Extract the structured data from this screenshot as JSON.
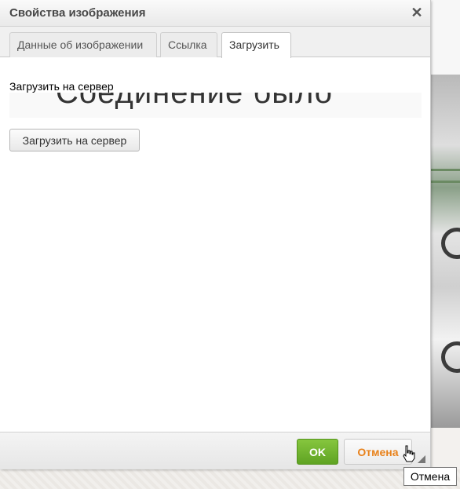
{
  "dialog": {
    "title": "Свойства изображения",
    "close_icon": "close-icon"
  },
  "tabs": [
    {
      "label": "Данные об изображении",
      "active": false
    },
    {
      "label": "Ссылка",
      "active": false
    },
    {
      "label": "Загрузить",
      "active": true
    }
  ],
  "upload": {
    "label": "Загрузить на сервер",
    "frame_message": "Соединение было",
    "button_label": "Загрузить на сервер"
  },
  "footer": {
    "ok_label": "OK",
    "cancel_label": "Отмена"
  },
  "tooltip": {
    "text": "Отмена"
  },
  "colors": {
    "ok_green": "#6fb52e",
    "cancel_orange": "#e8811a",
    "title_text": "#474747"
  }
}
